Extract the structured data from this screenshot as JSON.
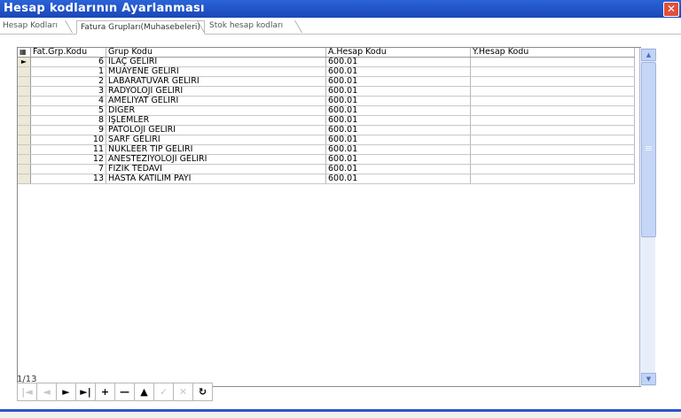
{
  "window": {
    "title": "Hesap kodlarının Ayarlanması"
  },
  "tabs": [
    {
      "label": "Hesap Kodları"
    },
    {
      "label": "Fatura Grupları(Muhasebeleri)"
    },
    {
      "label": "Stok hesap kodları"
    }
  ],
  "grid": {
    "columns": [
      "Fat.Grp.Kodu",
      "Grup Kodu",
      "A.Hesap Kodu",
      "Y.Hesap Kodu"
    ],
    "rows": [
      {
        "fat": "6",
        "grup": "İLAÇ GELİRİ",
        "a": "600.01",
        "y": ""
      },
      {
        "fat": "1",
        "grup": "MUAYENE GELİRİ",
        "a": "600.01",
        "y": ""
      },
      {
        "fat": "2",
        "grup": "LABARATUVAR GELİRİ",
        "a": "600.01",
        "y": ""
      },
      {
        "fat": "3",
        "grup": "RADYOLOJİ GELİRİ",
        "a": "600.01",
        "y": ""
      },
      {
        "fat": "4",
        "grup": "AMELİYAT GELİRİ",
        "a": "600.01",
        "y": ""
      },
      {
        "fat": "5",
        "grup": "DİĞER",
        "a": "600.01",
        "y": ""
      },
      {
        "fat": "8",
        "grup": "İŞLEMLER",
        "a": "600.01",
        "y": ""
      },
      {
        "fat": "9",
        "grup": "PATOLOJİ GELİRİ",
        "a": "600.01",
        "y": ""
      },
      {
        "fat": "10",
        "grup": "SARF GELİRİ",
        "a": "600.01",
        "y": ""
      },
      {
        "fat": "11",
        "grup": "NÜKLEER TIP GELİRİ",
        "a": "600.01",
        "y": ""
      },
      {
        "fat": "12",
        "grup": "ANESTEZİYOLOJİ GELİRİ",
        "a": "600.01",
        "y": ""
      },
      {
        "fat": "7",
        "grup": "FİZİK TEDAVİ",
        "a": "600.01",
        "y": ""
      },
      {
        "fat": "13",
        "grup": "HASTA KATILIM PAYI",
        "a": "600.01",
        "y": ""
      }
    ],
    "current_row_marker": "►"
  },
  "status": {
    "record": "1/13"
  },
  "navigator": [
    {
      "name": "first",
      "glyph": "|◄",
      "enabled": false
    },
    {
      "name": "prior",
      "glyph": "◄",
      "enabled": false
    },
    {
      "name": "next",
      "glyph": "►",
      "enabled": true
    },
    {
      "name": "last",
      "glyph": "►|",
      "enabled": true
    },
    {
      "name": "insert",
      "glyph": "+",
      "enabled": true
    },
    {
      "name": "delete",
      "glyph": "—",
      "enabled": true
    },
    {
      "name": "edit",
      "glyph": "▲",
      "enabled": true
    },
    {
      "name": "post",
      "glyph": "✓",
      "enabled": false
    },
    {
      "name": "cancel",
      "glyph": "✕",
      "enabled": false
    },
    {
      "name": "refresh",
      "glyph": "↻",
      "enabled": true
    }
  ]
}
